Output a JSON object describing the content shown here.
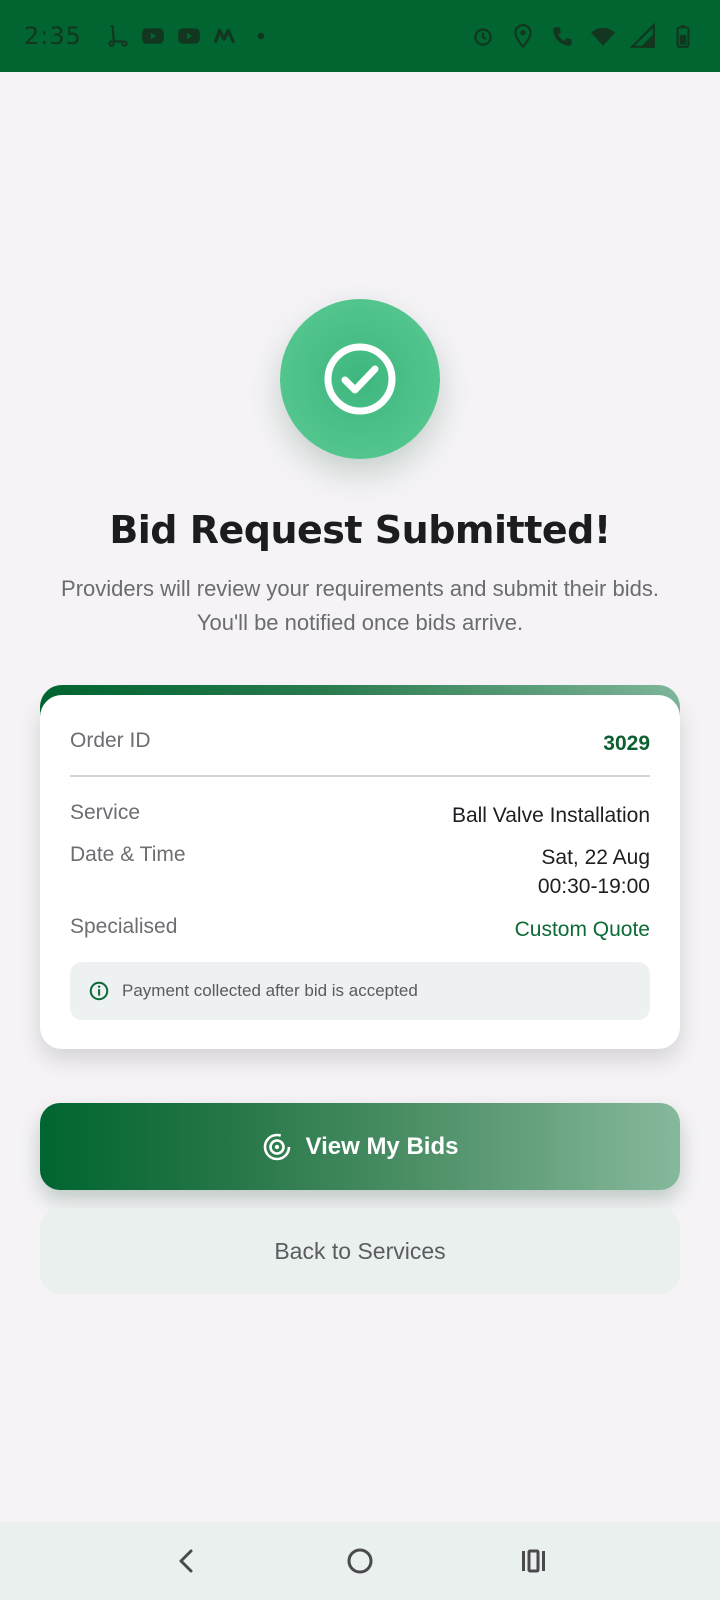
{
  "status_bar": {
    "time": "2:35",
    "left_icons": [
      "scooter-icon",
      "youtube-icon",
      "youtube-icon",
      "m-logo-icon",
      "dot-icon"
    ],
    "right_icons": [
      "alarm-icon",
      "location-icon",
      "wifi-call-icon",
      "wifi-icon",
      "signal-icon",
      "battery-icon"
    ]
  },
  "success": {
    "icon": "check-circle-icon",
    "title": "Bid Request Submitted!",
    "message": "Providers will review your requirements and submit their bids. You'll be notified once bids arrive."
  },
  "order_card": {
    "order_id_label": "Order ID",
    "order_id_value": "3029",
    "service_label": "Service",
    "service_value": "Ball Valve Installation",
    "datetime_label": "Date & Time",
    "date_value": "Sat, 22 Aug",
    "time_value": "00:30-19:00",
    "specialised_label": "Specialised",
    "specialised_value": "Custom Quote",
    "info_text": "Payment collected after bid is accepted"
  },
  "actions": {
    "primary_label": "View My Bids",
    "secondary_label": "Back to Services"
  },
  "colors": {
    "brand": "#006531",
    "success": "#4bc088",
    "background": "#f5f3f6"
  }
}
